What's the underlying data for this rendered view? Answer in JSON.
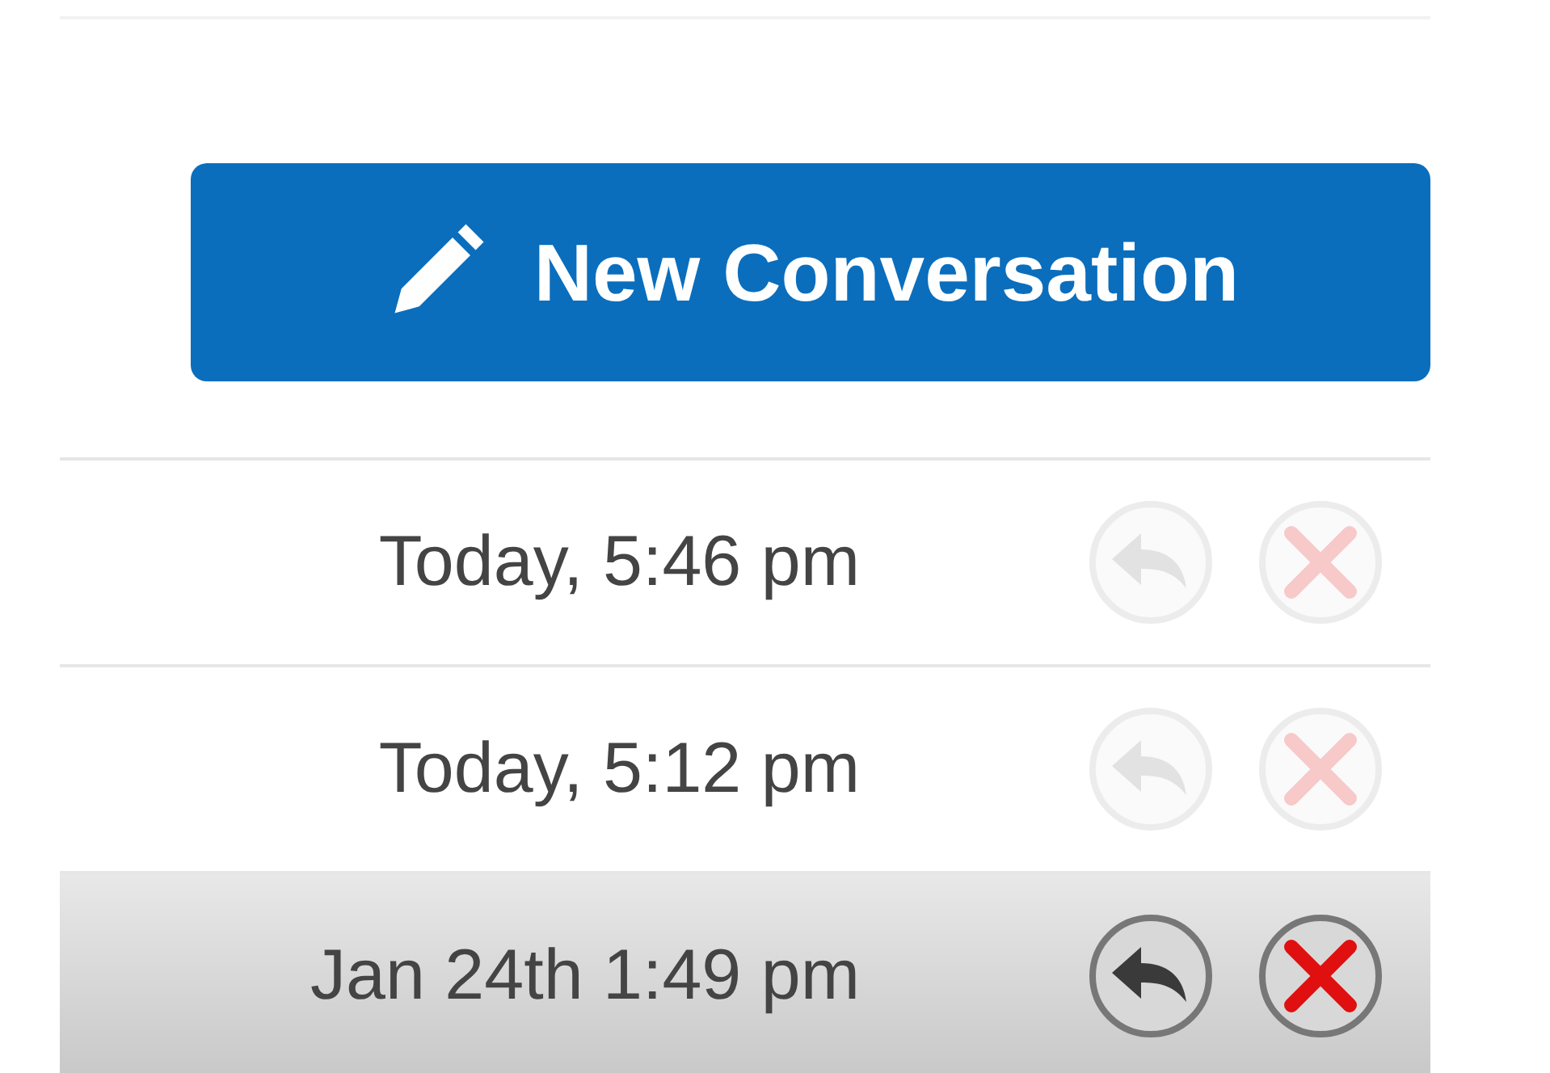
{
  "new_conversation_button": {
    "label": "New Conversation"
  },
  "conversations": [
    {
      "time": "Today, 5:46 pm",
      "highlighted": false
    },
    {
      "time": "Today, 5:12 pm",
      "highlighted": false
    },
    {
      "time": "Jan 24th 1:49 pm",
      "highlighted": true
    }
  ]
}
